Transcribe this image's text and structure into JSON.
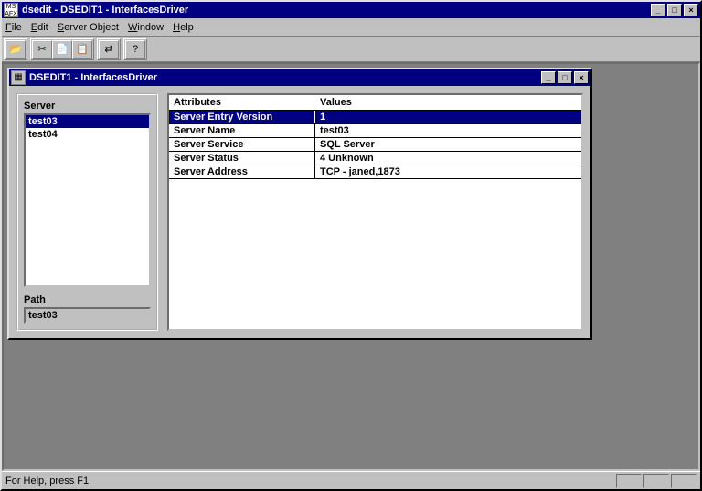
{
  "app": {
    "title": "dsedit - DSEDIT1 - InterfacesDriver"
  },
  "menu": {
    "file": "File",
    "edit": "Edit",
    "server_object": "Server Object",
    "window": "Window",
    "help": "Help"
  },
  "child": {
    "title": "DSEDIT1 - InterfacesDriver"
  },
  "left": {
    "server_label": "Server",
    "servers": [
      "test03",
      "test04"
    ],
    "selected_index": 0,
    "path_label": "Path",
    "path_value": "test03"
  },
  "right": {
    "header_attr": "Attributes",
    "header_val": "Values",
    "rows": [
      {
        "attr": "Server Entry Version",
        "val": "1",
        "selected": true
      },
      {
        "attr": "Server Name",
        "val": "test03",
        "selected": false
      },
      {
        "attr": "Server Service",
        "val": "SQL Server",
        "selected": false
      },
      {
        "attr": "Server Status",
        "val": "4   Unknown",
        "selected": false
      },
      {
        "attr": "Server Address",
        "val": "TCP - janed,1873",
        "selected": false
      }
    ]
  },
  "status": {
    "text": "For Help, press F1"
  },
  "icons": {
    "open": "📂",
    "cut": "✂",
    "copy": "📄",
    "paste": "📋",
    "ping": "⇄",
    "help": "?"
  }
}
